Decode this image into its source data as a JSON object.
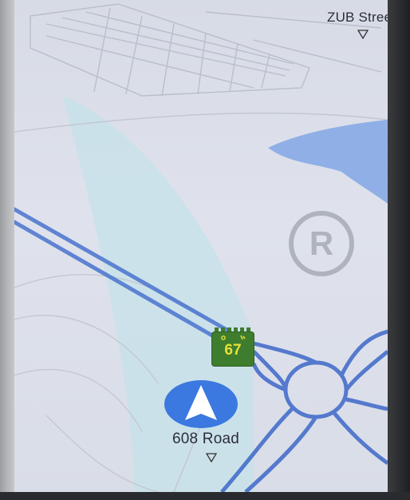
{
  "map": {
    "street_top": "ZUB Street",
    "street_bottom": "608 Road",
    "speed_limit": "67",
    "colors": {
      "background": "#dfe2ec",
      "road": "#3e6fd0",
      "water": "#7fa6e6",
      "highlight": "#c4e0e8",
      "speed_sign": "#3f7d2e",
      "speed_text": "#e7e035",
      "nav_arrow": "#3b78e0"
    },
    "icons": {
      "position": "navigation-arrow-icon",
      "speed": "speed-limit-sign-icon",
      "watermark": "registered-trademark-icon",
      "street_marker": "street-marker-icon"
    }
  }
}
